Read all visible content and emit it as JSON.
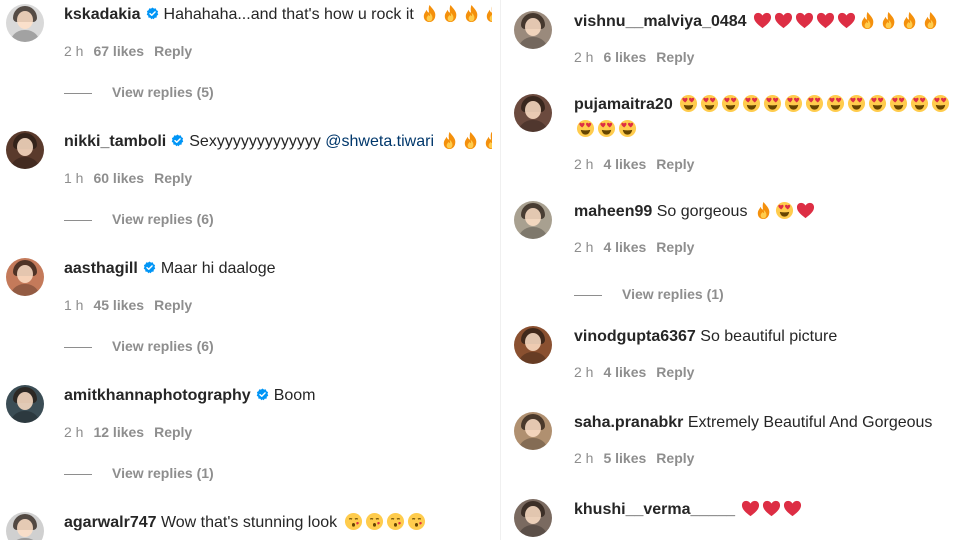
{
  "colors": {
    "accent": "#0095f6",
    "text": "#262626",
    "muted": "#8e8e8e",
    "mention": "#00376b"
  },
  "left_comments": [
    {
      "user": "kskadakia",
      "verified": true,
      "text": "Hahahaha...and that's how u rock it",
      "emojis": [
        "fire",
        "fire",
        "fire",
        "fire"
      ],
      "time": "2 h",
      "likes": "67 likes",
      "reply": "Reply",
      "view_replies": "View replies (5)",
      "avatar": "#d9d9d9"
    },
    {
      "user": "nikki_tamboli",
      "verified": true,
      "text": "Sexyyyyyyyyyyyyy",
      "mention": "@shweta.tiwari",
      "emojis": [
        "fire",
        "fire",
        "fire"
      ],
      "time": "1 h",
      "likes": "60 likes",
      "reply": "Reply",
      "view_replies": "View replies (6)",
      "avatar": "#5a3a2c"
    },
    {
      "user": "aasthagill",
      "verified": true,
      "text": "Maar hi daaloge",
      "emojis": [],
      "time": "1 h",
      "likes": "45 likes",
      "reply": "Reply",
      "view_replies": "View replies (6)",
      "avatar": "#c47a5a"
    },
    {
      "user": "amitkhannaphotography",
      "verified": true,
      "text": "Boom",
      "emojis": [],
      "time": "2 h",
      "likes": "12 likes",
      "reply": "Reply",
      "view_replies": "View replies (1)",
      "avatar": "#3b4d55"
    },
    {
      "user": "agarwalr747",
      "verified": false,
      "text": "Wow that's stunning look",
      "emojis": [
        "kiss",
        "kiss",
        "kiss",
        "kiss"
      ],
      "avatar": "#d0d0d0"
    }
  ],
  "right_comments": [
    {
      "user": "vishnu__malviya_0484",
      "text": "",
      "emojis": [
        "heart",
        "heart",
        "heart",
        "heart",
        "heart",
        "fire",
        "fire",
        "fire",
        "fire"
      ],
      "time": "2 h",
      "likes": "6 likes",
      "reply": "Reply",
      "avatar": "#9a8a7c"
    },
    {
      "user": "pujamaitra20",
      "text": "",
      "emojis": [
        "hearteyes",
        "hearteyes",
        "hearteyes",
        "hearteyes",
        "hearteyes",
        "hearteyes",
        "hearteyes",
        "hearteyes",
        "hearteyes",
        "hearteyes",
        "hearteyes",
        "hearteyes",
        "hearteyes"
      ],
      "emojis2": [
        "hearteyes",
        "hearteyes",
        "hearteyes"
      ],
      "time": "2 h",
      "likes": "4 likes",
      "reply": "Reply",
      "avatar": "#6b4a3e"
    },
    {
      "user": "maheen99",
      "text": "So gorgeous",
      "emojis": [
        "fire",
        "hearteyes",
        "heart"
      ],
      "time": "2 h",
      "likes": "4 likes",
      "reply": "Reply",
      "view_replies": "View replies (1)",
      "avatar": "#a8a090"
    },
    {
      "user": "vinodgupta6367",
      "text": "So beautiful picture",
      "emojis": [],
      "time": "2 h",
      "likes": "4 likes",
      "reply": "Reply",
      "avatar": "#8a5030"
    },
    {
      "user": "saha.pranabkr",
      "text": "Extremely Beautiful And Gorgeous",
      "emojis": [],
      "time": "2 h",
      "likes": "5 likes",
      "reply": "Reply",
      "avatar": "#b09070"
    },
    {
      "user": "khushi__verma_____",
      "text": "",
      "emojis": [
        "heart",
        "heart",
        "heart"
      ],
      "avatar": "#7a6a60"
    }
  ]
}
